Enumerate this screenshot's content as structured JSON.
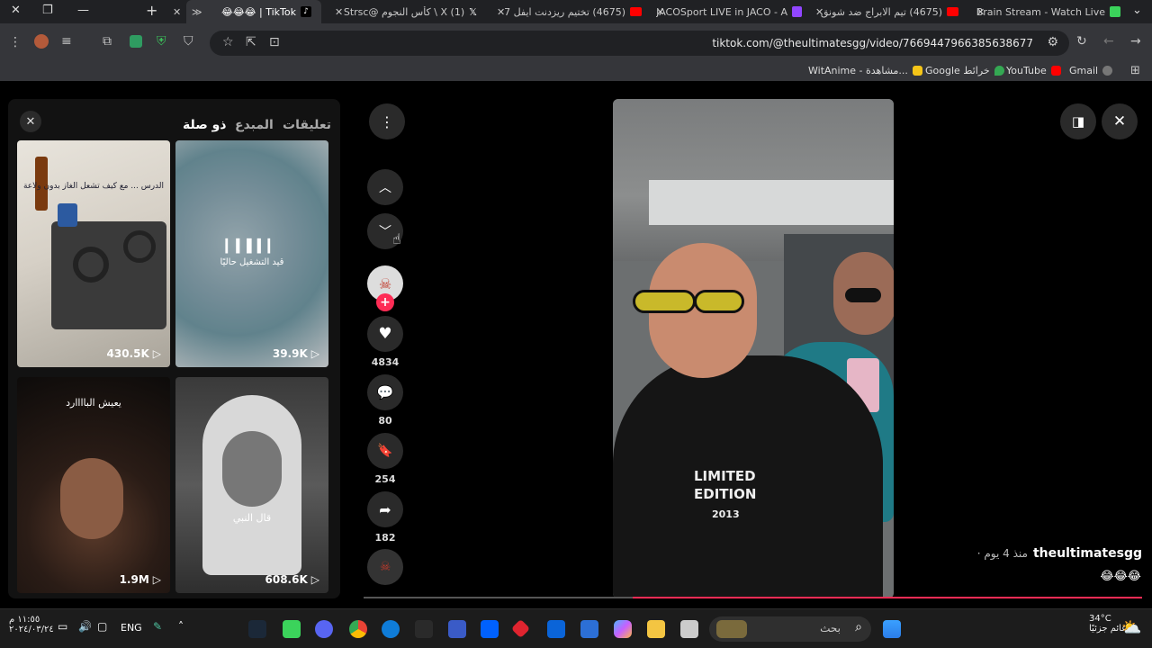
{
  "tabs": [
    {
      "title": "Brain Stream - Watch Live",
      "favicon_color": "#3bd35b"
    },
    {
      "title": "(4675) تيم الابراج ضد شونق",
      "favicon_color": "#ff0000"
    },
    {
      "title": "JACOSport LIVE in JACO - A",
      "favicon_color": "#9146ff"
    },
    {
      "title": "(4675) تختيم ريزدنت ايفل 7",
      "favicon_color": "#ff0000"
    },
    {
      "title": "(1) X \\ كأس النجوم @Strsc",
      "favicon_color": "#ffffff"
    },
    {
      "title": "TikTok | 😂😂😂",
      "favicon_color": "#000000",
      "active": true
    }
  ],
  "toolbar": {
    "url": "tiktok.com/@theultimatesgg/video/7669447966385638677"
  },
  "bookmarks": [
    {
      "label": "Gmail",
      "color": "#ea4335"
    },
    {
      "label": "YouTube",
      "color": "#ff0000"
    },
    {
      "label": "Google خرائط",
      "color": "#34a853"
    },
    {
      "label": "WitAnime - مشاهدة...",
      "color": "#f5c518"
    }
  ],
  "panel": {
    "tabs": {
      "comments": "تعليقات",
      "creator": "المبدع",
      "related": "ذو صلة"
    },
    "videos": [
      {
        "views": "430.5K",
        "caption": "الدرس ... مع كيف تشعل الغاز بدون ولاعة"
      },
      {
        "views": "39.9K",
        "caption": "قيد التشغيل حاليًا"
      },
      {
        "views": "1.9M",
        "caption": "يعيش الباااارد"
      },
      {
        "views": "608.6K",
        "caption": "قال النبي"
      }
    ]
  },
  "actions": {
    "likes": "4834",
    "comments": "80",
    "saves": "254",
    "shares": "182"
  },
  "video_info": {
    "author": "theultimatesgg",
    "time": "· منذ 4 يوم",
    "caption": "😂😂😂",
    "shirt_text_1": "LIMITED",
    "shirt_text_2": "EDITION",
    "shirt_year": "2013"
  },
  "colors": {
    "accent": "#fe2c55",
    "tab_bar": "#202124",
    "toolbar": "#35363a"
  },
  "taskbar": {
    "weather_temp": "34°C",
    "weather_desc": "غائم جزئيًا",
    "search_label": "بحث",
    "lang": "ENG",
    "time": "١١:٥٥ م",
    "date": "٢٠٢٤/٠٣/٢٤"
  }
}
